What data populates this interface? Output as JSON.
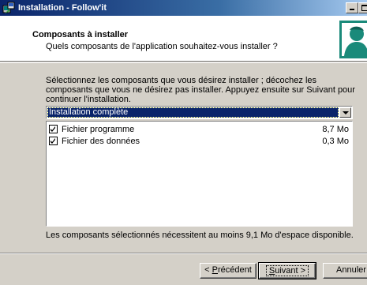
{
  "window": {
    "title": "Installation - Follow'it"
  },
  "header": {
    "title": "Composants à installer",
    "subtitle": "Quels composants de l'application souhaitez-vous installer ?"
  },
  "body": {
    "description": "Sélectionnez les composants que vous désirez installer ; décochez les composants que vous ne désirez pas installer. Appuyez ensuite sur Suivant pour continuer l'installation.",
    "install_type": "Installation complète",
    "components": [
      {
        "label": "Fichier programme",
        "size": "8,7 Mo",
        "checked": true
      },
      {
        "label": "Fichier des données",
        "size": "0,3 Mo",
        "checked": true
      }
    ],
    "space_required": "Les composants sélectionnés nécessitent au moins 9,1 Mo d'espace disponible."
  },
  "buttons": {
    "prev_prefix": "< ",
    "prev_accel": "P",
    "prev_rest": "récédent",
    "next_accel": "S",
    "next_rest": "uivant >",
    "cancel": "Annuler"
  },
  "colors": {
    "titlebar_start": "#0a246a",
    "selection": "#0a246a",
    "face": "#d4d0c8",
    "logo": "#1a8a7a"
  }
}
